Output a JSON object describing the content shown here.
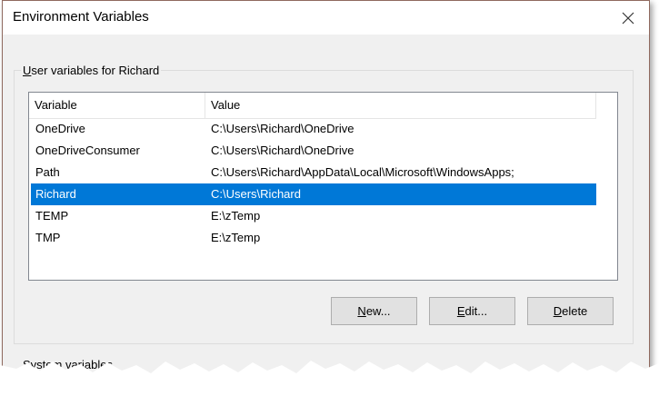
{
  "window": {
    "title": "Environment Variables"
  },
  "user_group": {
    "label": "User variables for Richard"
  },
  "list": {
    "headers": {
      "variable": "Variable",
      "value": "Value"
    },
    "rows": [
      {
        "variable": "OneDrive",
        "value": "C:\\Users\\Richard\\OneDrive"
      },
      {
        "variable": "OneDriveConsumer",
        "value": "C:\\Users\\Richard\\OneDrive"
      },
      {
        "variable": "Path",
        "value": "C:\\Users\\Richard\\AppData\\Local\\Microsoft\\WindowsApps;"
      },
      {
        "variable": "Richard",
        "value": "C:\\Users\\Richard",
        "selected": true
      },
      {
        "variable": "TEMP",
        "value": "E:\\zTemp"
      },
      {
        "variable": "TMP",
        "value": "E:\\zTemp"
      }
    ]
  },
  "buttons": {
    "new": {
      "accel": "N",
      "rest": "ew..."
    },
    "edit": {
      "accel": "E",
      "rest": "dit..."
    },
    "delete": {
      "accel": "D",
      "rest": "elete"
    }
  },
  "system_group": {
    "label": "System variables"
  },
  "colors": {
    "selection": "#0078d7",
    "border": "#8f6a5f"
  },
  "icons": {
    "close": "close-icon"
  }
}
